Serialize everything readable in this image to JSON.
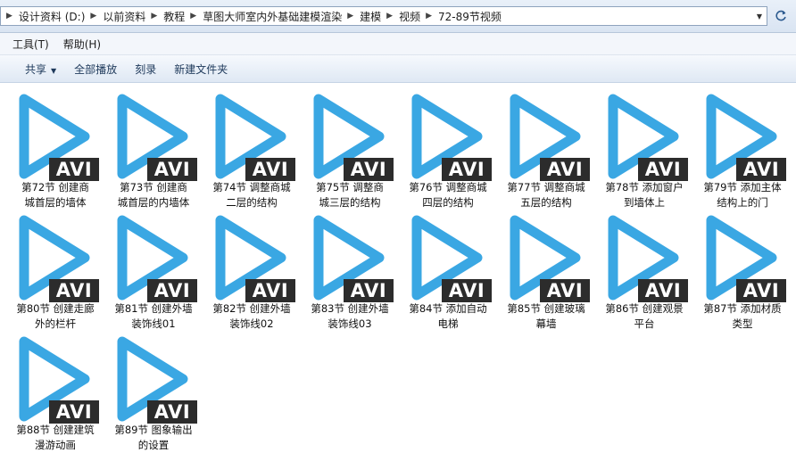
{
  "address_bar": {
    "crumbs": [
      "设计资料 (D:)",
      "以前资料",
      "教程",
      "草图大师室内外基础建模渲染",
      "建模",
      "视频",
      "72-89节视频"
    ],
    "chevron_icon": "chevron-right-icon",
    "dropdown_icon": "chevron-down-icon",
    "refresh_icon": "refresh-icon"
  },
  "menu": {
    "items": [
      "工具(T)",
      "帮助(H)"
    ]
  },
  "toolbar": {
    "share_label": "共享",
    "play_all_label": "全部播放",
    "burn_label": "刻录",
    "new_folder_label": "新建文件夹"
  },
  "files": {
    "badge": "AVI",
    "icon": "video-play-icon",
    "accent": "#3aa7e3",
    "items": [
      {
        "line1": "第72节  创建商",
        "line2": "城首层的墙体"
      },
      {
        "line1": "第73节  创建商",
        "line2": "城首层的内墙体"
      },
      {
        "line1": "第74节  调整商城",
        "line2": "二层的结构"
      },
      {
        "line1": "第75节  调整商",
        "line2": "城三层的结构"
      },
      {
        "line1": "第76节  调整商城",
        "line2": "四层的结构"
      },
      {
        "line1": "第77节  调整商城",
        "line2": "五层的结构"
      },
      {
        "line1": "第78节  添加窗户",
        "line2": "到墙体上"
      },
      {
        "line1": "第79节  添加主体",
        "line2": "结构上的门"
      },
      {
        "line1": "第80节  创建走廊",
        "line2": "外的栏杆"
      },
      {
        "line1": "第81节  创建外墙",
        "line2": "装饰线01"
      },
      {
        "line1": "第82节  创建外墙",
        "line2": "装饰线02"
      },
      {
        "line1": "第83节  创建外墙",
        "line2": "装饰线03"
      },
      {
        "line1": "第84节  添加自动",
        "line2": "电梯"
      },
      {
        "line1": "第85节  创建玻璃",
        "line2": "幕墙"
      },
      {
        "line1": "第86节  创建观景",
        "line2": "平台"
      },
      {
        "line1": "第87节  添加材质",
        "line2": "类型"
      },
      {
        "line1": "第88节  创建建筑",
        "line2": "漫游动画"
      },
      {
        "line1": "第89节  图象输出",
        "line2": "的设置"
      }
    ]
  }
}
